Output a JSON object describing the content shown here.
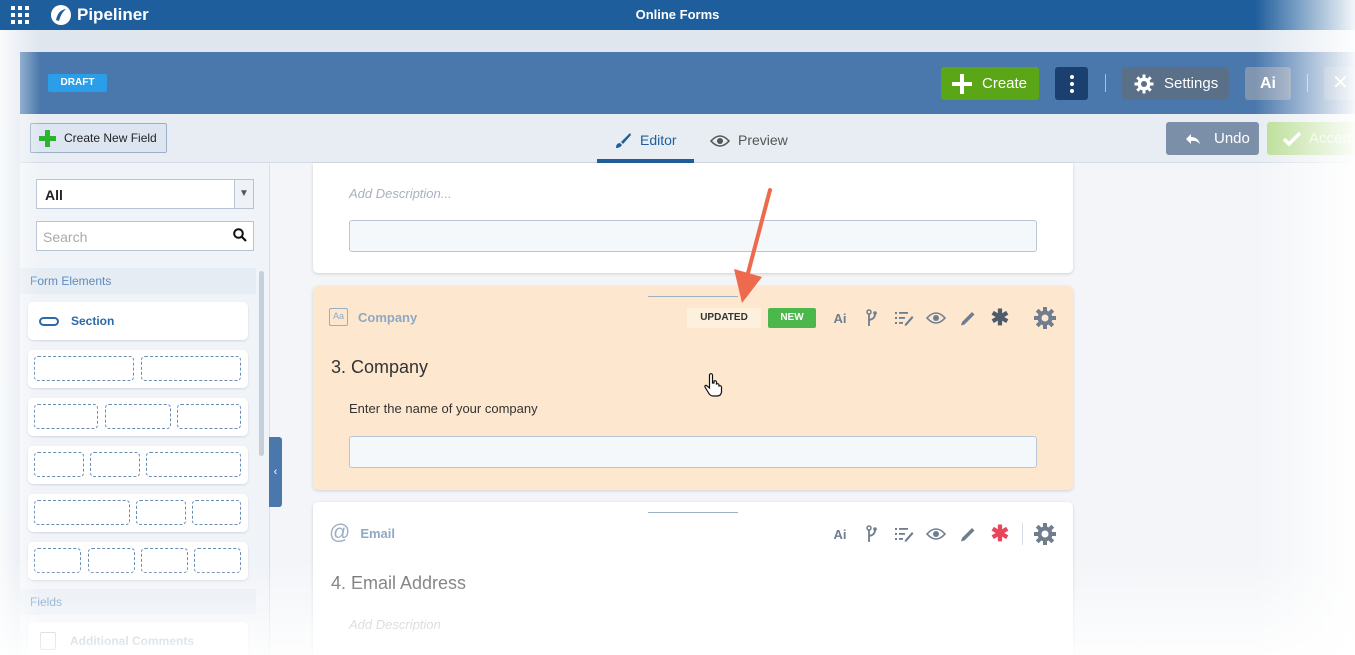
{
  "app": {
    "brand": "Pipeliner",
    "title": "Online Forms"
  },
  "header": {
    "status_badge": "DRAFT",
    "create_label": "Create",
    "settings_label": "Settings",
    "ai_label": "Ai",
    "close_label": "✕"
  },
  "toolbar": {
    "new_field_label": "Create New Field",
    "tabs": [
      {
        "label": "Editor",
        "active": true
      },
      {
        "label": "Preview",
        "active": false
      }
    ],
    "undo_label": "Undo",
    "accept_label": "Accept"
  },
  "left_panel": {
    "filter_value": "All",
    "search_placeholder": "Search",
    "form_elements_label": "Form Elements",
    "section_label": "Section",
    "fields_label": "Fields",
    "first_field": "Additional Comments"
  },
  "cards": {
    "top": {
      "description_placeholder": "Add Description..."
    },
    "company": {
      "type_label": "Company",
      "badge_updated": "UPDATED",
      "badge_new": "NEW",
      "question": "3. Company",
      "description": "Enter the name of your company"
    },
    "email": {
      "type_label": "Email",
      "question": "4. Email Address",
      "description_placeholder": "Add Description"
    }
  },
  "icons": {
    "required_active_color": "#e8445a",
    "accent": "#1f5e9c",
    "highlight_bg": "#fde8cf",
    "arrow_color": "#ee6a4c"
  }
}
